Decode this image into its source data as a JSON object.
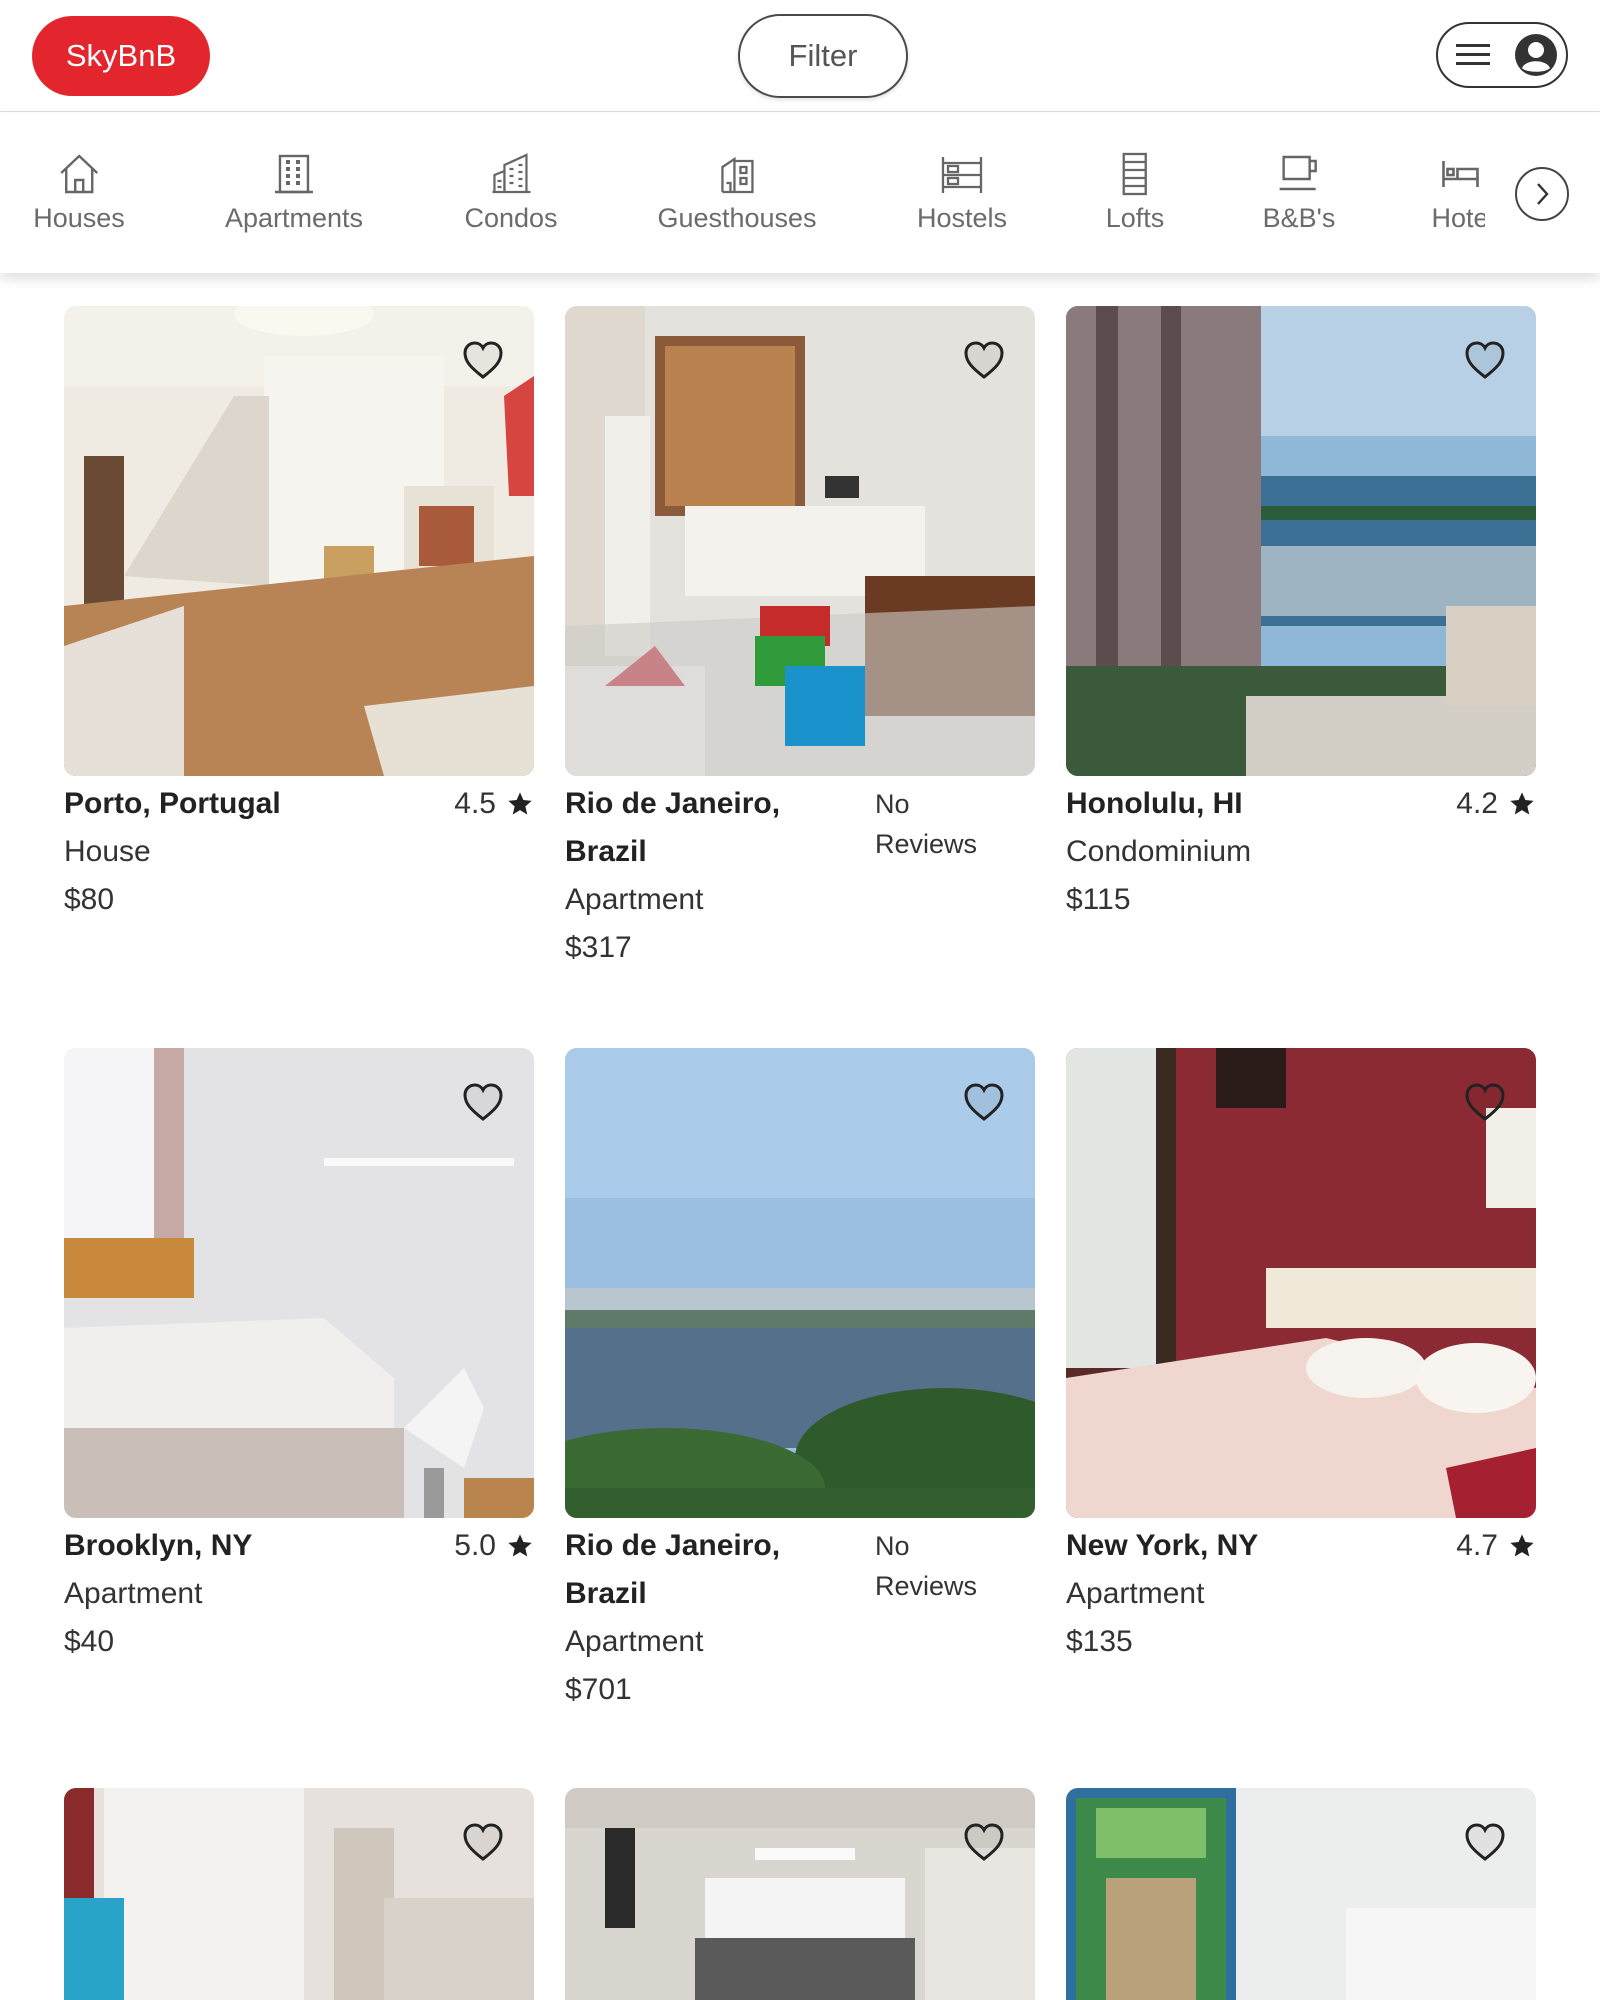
{
  "header": {
    "logo": "SkyBnB",
    "filter_label": "Filter"
  },
  "categories": [
    {
      "label": "Houses",
      "icon": "house-icon"
    },
    {
      "label": "Apartments",
      "icon": "apartment-icon"
    },
    {
      "label": "Condos",
      "icon": "condo-icon"
    },
    {
      "label": "Guesthouses",
      "icon": "guesthouse-icon"
    },
    {
      "label": "Hostels",
      "icon": "hostel-icon"
    },
    {
      "label": "Lofts",
      "icon": "loft-icon"
    },
    {
      "label": "B&B's",
      "icon": "coffee-cup-icon"
    },
    {
      "label": "Hote",
      "icon": "hotel-bed-icon"
    }
  ],
  "listings": [
    {
      "city": "Porto, Portugal",
      "rating": "4.5",
      "type": "House",
      "price": "$80"
    },
    {
      "city": "Rio de Janeiro, Brazil",
      "reviews": "No Reviews",
      "type": "Apartment",
      "price": "$317"
    },
    {
      "city": "Honolulu, HI",
      "rating": "4.2",
      "type": "Condominium",
      "price": "$115"
    },
    {
      "city": "Brooklyn, NY",
      "rating": "5.0",
      "type": "Apartment",
      "price": "$40"
    },
    {
      "city": "Rio de Janeiro, Brazil",
      "reviews": "No Reviews",
      "type": "Apartment",
      "price": "$701"
    },
    {
      "city": "New York, NY",
      "rating": "4.7",
      "type": "Apartment",
      "price": "$135"
    }
  ],
  "colors": {
    "brand": "#e3262d"
  }
}
